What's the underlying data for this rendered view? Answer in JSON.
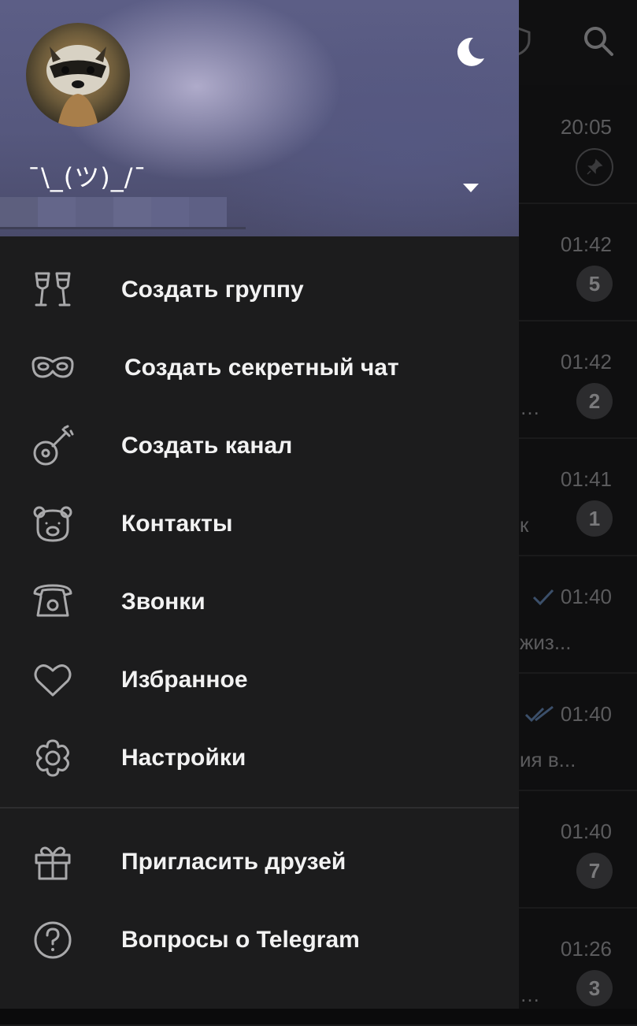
{
  "drawer": {
    "profile_name": "¯\\_(ツ)_/¯",
    "menu": [
      {
        "label": "Создать группу",
        "icon": "wine-glasses-icon"
      },
      {
        "label": "Создать секретный чат",
        "icon": "mask-icon"
      },
      {
        "label": "Создать канал",
        "icon": "guitar-icon"
      },
      {
        "label": "Контакты",
        "icon": "bear-icon"
      },
      {
        "label": "Звонки",
        "icon": "telephone-icon"
      },
      {
        "label": "Избранное",
        "icon": "heart-icon"
      },
      {
        "label": "Настройки",
        "icon": "flower-gear-icon"
      }
    ],
    "menu_secondary": [
      {
        "label": "Пригласить друзей",
        "icon": "gift-icon"
      },
      {
        "label": "Вопросы о Telegram",
        "icon": "question-circle-icon"
      }
    ]
  },
  "chat_list": {
    "rows": [
      {
        "time": "20:05",
        "pinned": true,
        "badge": "",
        "snippet": ""
      },
      {
        "time": "01:42",
        "badge": "5",
        "snippet": ""
      },
      {
        "time": "01:42",
        "badge": "2",
        "snippet": "…"
      },
      {
        "time": "01:41",
        "badge": "1",
        "snippet": "к"
      },
      {
        "time": "01:40",
        "check": "single",
        "badge": "",
        "snippet": "жиз..."
      },
      {
        "time": "01:40",
        "check": "double",
        "badge": "",
        "snippet": "ия в..."
      },
      {
        "time": "01:40",
        "badge": "7",
        "snippet": ""
      },
      {
        "time": "01:26",
        "badge": "3",
        "snippet": "…"
      }
    ]
  },
  "colors": {
    "drawer_bg": "#1c1c1d",
    "header_bg": "#56587e",
    "text": "#f2f2f2",
    "icon": "#a9a9ab"
  }
}
